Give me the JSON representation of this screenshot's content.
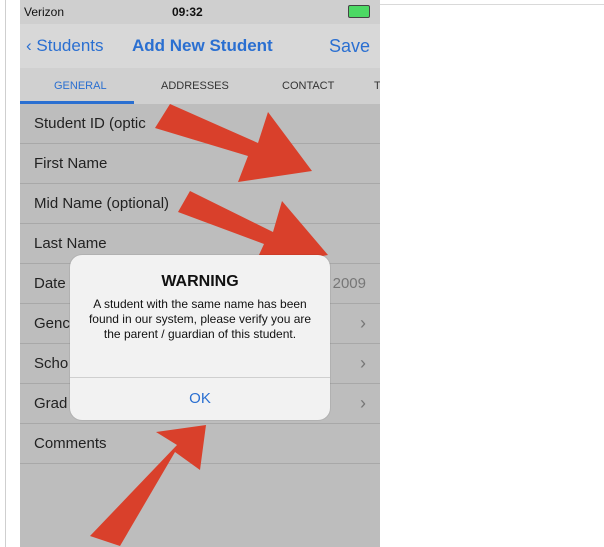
{
  "status": {
    "carrier": "Verizon",
    "time": "09:32"
  },
  "nav": {
    "back_label": "Students",
    "title": "Add New Student",
    "save_label": "Save"
  },
  "tabs": [
    "GENERAL",
    "ADDRESSES",
    "CONTACT",
    "T"
  ],
  "rows": [
    {
      "label": "Student ID (optic"
    },
    {
      "label": "First Name"
    },
    {
      "label": "Mid Name (optional)"
    },
    {
      "label": "Last Name"
    },
    {
      "label": "Date",
      "value": "2009"
    },
    {
      "label": "Genc"
    },
    {
      "label": "Scho"
    },
    {
      "label": "Grad"
    },
    {
      "label": "Comments"
    }
  ],
  "alert": {
    "title": "WARNING",
    "message": "A student with the same name has been found in our system, please verify you are the parent / guardian of this student.",
    "ok": "OK"
  },
  "colors": {
    "accent": "#2a6fd1",
    "arrow": "#d9402b"
  }
}
